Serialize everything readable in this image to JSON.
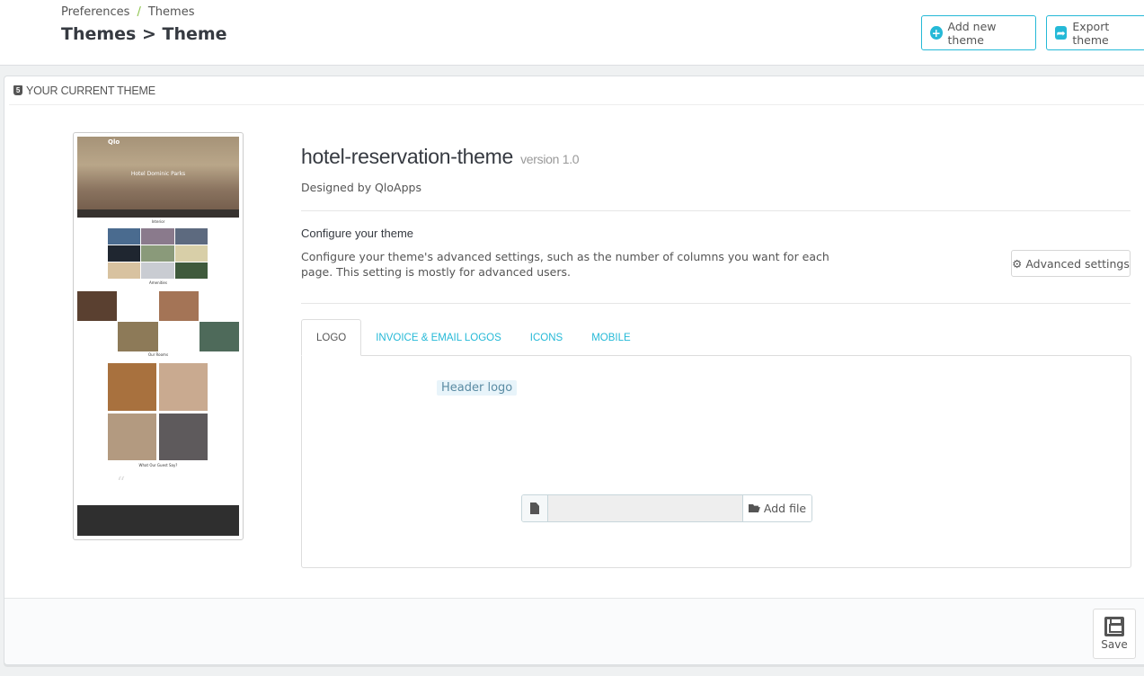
{
  "header": {
    "breadcrumb": [
      "Preferences",
      "Themes"
    ],
    "breadcrumb_separator": "/",
    "title": "Themes > Theme",
    "buttons": {
      "add_new_theme": {
        "label": "Add new theme",
        "icon": "plus-circle-icon"
      },
      "export_theme": {
        "label": "Export theme",
        "icon": "share-icon"
      }
    }
  },
  "panel": {
    "heading": "YOUR CURRENT THEME",
    "heading_icon": "html5-icon",
    "preview": {
      "logo": "Qlo",
      "hero_title": "Hotel Dominic Parks",
      "sections": [
        "Interior",
        "Amenities",
        "Our Rooms",
        "What Our Guest Say?"
      ]
    },
    "theme": {
      "name": "hotel-reservation-theme",
      "version": "version 1.0",
      "designed_by": "Designed by QloApps"
    },
    "configure": {
      "title": "Configure your theme",
      "description": "Configure your theme's advanced settings, such as the number of columns you want for each page. This setting is mostly for advanced users.",
      "advanced_button": "Advanced settings"
    },
    "tabs": [
      {
        "label": "LOGO",
        "active": true
      },
      {
        "label": "INVOICE & EMAIL LOGOS",
        "active": false
      },
      {
        "label": "ICONS",
        "active": false
      },
      {
        "label": "MOBILE",
        "active": false
      }
    ],
    "logo_tab": {
      "label": "Header logo",
      "file_value": "",
      "add_file_label": "Add file"
    },
    "footer": {
      "save_label": "Save"
    }
  },
  "colors": {
    "accent": "#25b9d7",
    "title": "#363a41",
    "text": "#555555",
    "background": "#eff1f2"
  }
}
